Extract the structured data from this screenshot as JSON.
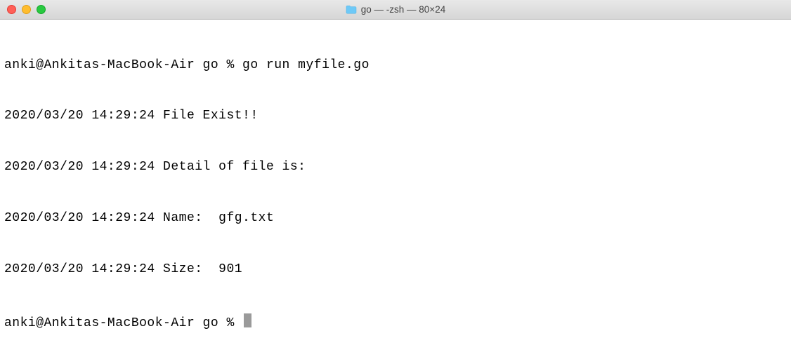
{
  "window": {
    "title": "go — -zsh — 80×24"
  },
  "terminal": {
    "lines": {
      "l0": "anki@Ankitas-MacBook-Air go % go run myfile.go",
      "l1": "2020/03/20 14:29:24 File Exist!!",
      "l2": "2020/03/20 14:29:24 Detail of file is:",
      "l3": "2020/03/20 14:29:24 Name:  gfg.txt",
      "l4": "2020/03/20 14:29:24 Size:  901",
      "l5": "anki@Ankitas-MacBook-Air go % "
    }
  }
}
